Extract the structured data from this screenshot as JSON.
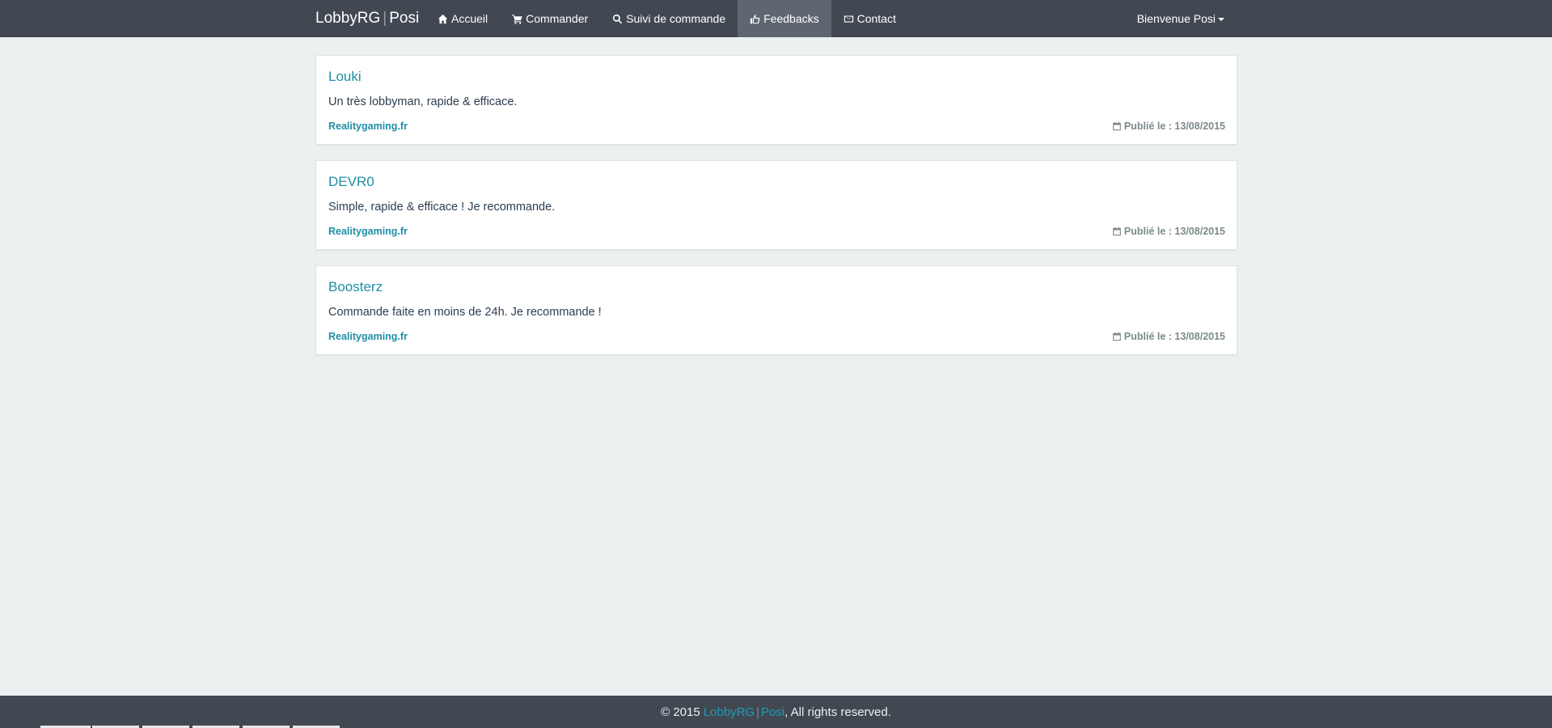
{
  "nav": {
    "brand_left": "LobbyRG",
    "brand_right": "Posi",
    "links": [
      {
        "label": "Accueil",
        "icon": "home-icon",
        "active": false
      },
      {
        "label": "Commander",
        "icon": "cart-icon",
        "active": false
      },
      {
        "label": "Suivi de commande",
        "icon": "search-icon",
        "active": false
      },
      {
        "label": "Feedbacks",
        "icon": "thumbs-up-icon",
        "active": true
      },
      {
        "label": "Contact",
        "icon": "envelope-icon",
        "active": false
      }
    ],
    "user_menu": "Bienvenue Posi"
  },
  "feedbacks": [
    {
      "author": "Louki",
      "text": "Un très lobbyman, rapide & efficace.",
      "source": "Realitygaming.fr",
      "date": "Publié le : 13/08/2015"
    },
    {
      "author": "DEVR0",
      "text": "Simple, rapide & efficace ! Je recommande.",
      "source": "Realitygaming.fr",
      "date": "Publié le : 13/08/2015"
    },
    {
      "author": "Boosterz",
      "text": "Commande faite en moins de 24h. Je recommande !",
      "source": "Realitygaming.fr",
      "date": "Publié le : 13/08/2015"
    }
  ],
  "footer": {
    "prefix": "© 2015",
    "brand_left": "LobbyRG",
    "brand_right": "Posi",
    "suffix": ", All rights reserved."
  },
  "colors": {
    "navbar": "#424852",
    "accent": "#1f8fa6",
    "background": "#ecf0f1"
  }
}
